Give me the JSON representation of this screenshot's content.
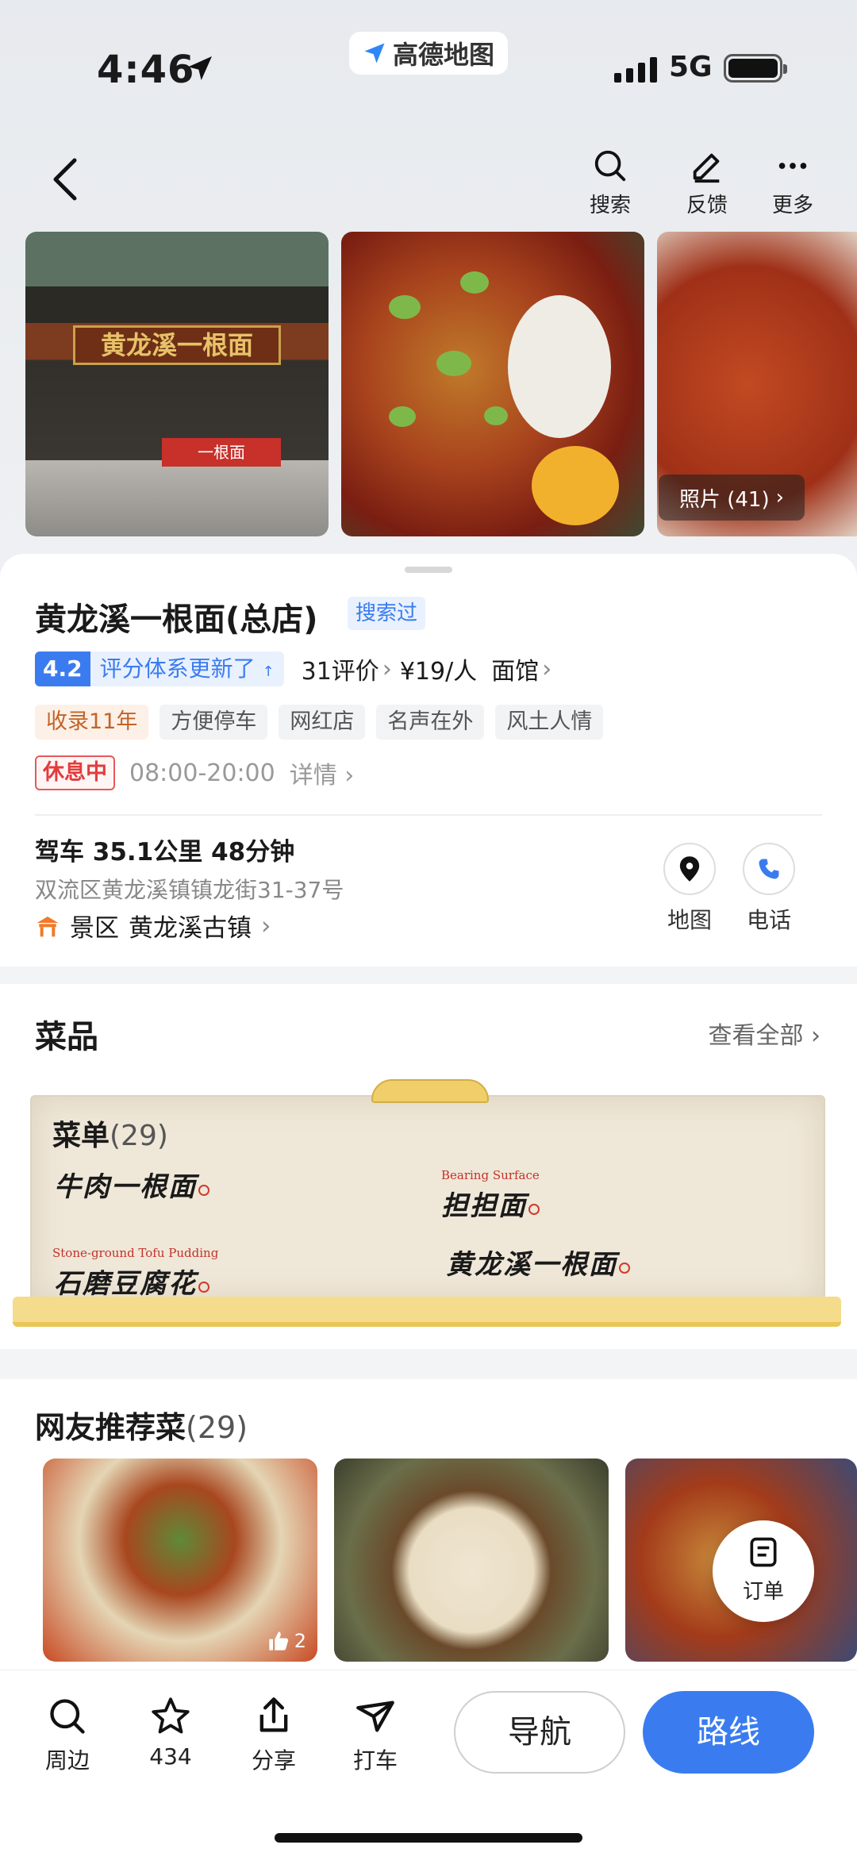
{
  "status_bar": {
    "time": "4:46",
    "app_name": "高德地图",
    "network": "5G"
  },
  "nav": {
    "search": "搜索",
    "feedback": "反馈",
    "more": "更多"
  },
  "photos": {
    "count_label": "照片 (41)"
  },
  "place": {
    "name": "黄龙溪一根面(总店)",
    "searched_badge": "搜索过",
    "rating": "4.2",
    "rating_note": "评分体系更新了",
    "reviews": "31评价",
    "price": "¥19/人",
    "category": "面馆",
    "tags": [
      "收录11年",
      "方便停车",
      "网红店",
      "名声在外",
      "风土人情"
    ],
    "status": "休息中",
    "hours": "08:00-20:00",
    "hours_detail": "详情",
    "drive": "驾车 35.1公里 48分钟",
    "address": "双流区黄龙溪镇镇龙街31-37号",
    "scenic_label": "景区",
    "scenic_name": "黄龙溪古镇",
    "map_label": "地图",
    "phone_label": "电话"
  },
  "dishes": {
    "title": "菜品",
    "see_all": "查看全部",
    "menu_title": "菜单",
    "menu_count": "(29)",
    "items": [
      {
        "name": "牛肉一根面",
        "en": ""
      },
      {
        "name": "担担面",
        "en": "Bearing Surface"
      },
      {
        "name": "石磨豆腐花",
        "en": "Stone-ground Tofu Pudding"
      },
      {
        "name": "黄龙溪一根面",
        "en": ""
      }
    ]
  },
  "recommended": {
    "title": "网友推荐菜",
    "count": "(29)",
    "likes": "2",
    "order_label": "订单"
  },
  "bottom_bar": {
    "nearby": "周边",
    "favorites": "434",
    "share": "分享",
    "taxi": "打车",
    "navigate": "导航",
    "route": "路线"
  },
  "colors": {
    "accent": "#3a7cf0",
    "closed": "#e23c3c",
    "tag_orange": "#c0642a"
  }
}
